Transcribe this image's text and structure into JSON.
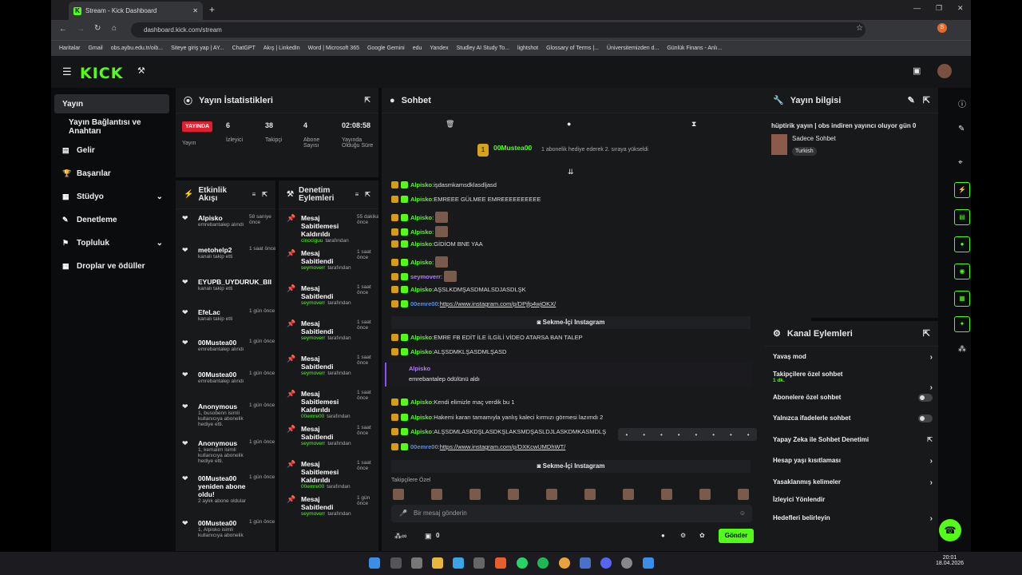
{
  "browser": {
    "tab_title": "Stream - Kick Dashboard",
    "url": "dashboard.kick.com/stream",
    "bookmarks": [
      "Haritalar",
      "Gmail",
      "obs.aybu.edu.tr/oib...",
      "Siteye giriş yap | AY...",
      "ChatGPT",
      "Akış | LinkedIn",
      "Word | Microsoft 365",
      "Google Gemini",
      "edu",
      "Yandex",
      "Studley AI Study To...",
      "lightshot",
      "Glossary of Terms |...",
      "Üniversitemizden d...",
      "Günlük Finans - Anlı..."
    ]
  },
  "nav": {
    "items": [
      "Yayın",
      "Yayın Bağlantısı ve Anahtarı",
      "Gelir",
      "Başarılar",
      "Stüdyo",
      "Denetleme",
      "Topluluk",
      "Droplar ve ödüller"
    ]
  },
  "stats": {
    "title": "Yayın İstatistikleri",
    "live": "YAYINDA",
    "live_label": "Yayın",
    "viewers": "6",
    "viewers_label": "İzleyici",
    "followers": "38",
    "followers_label": "Takipçi",
    "subs": "4",
    "subs_label": "Abone Sayısı",
    "duration": "02:08:58",
    "duration_label": "Yayında Olduğu Süre"
  },
  "activity": {
    "title": "Etkinlik Akışı",
    "items": [
      {
        "name": "Alpisko",
        "time": "58 saniye önce",
        "sub": "emrebantalep alındı"
      },
      {
        "name": "metohelp2",
        "time": "1 saat önce",
        "sub": "kanalı takip etti"
      },
      {
        "name": "EYUPB_UYDURUK_BII",
        "time": "",
        "sub": "kanalı takip etti"
      },
      {
        "name": "EfeLac",
        "time": "1 gün önce",
        "sub": "kanalı takip etti"
      },
      {
        "name": "00Mustea00",
        "time": "1 gün önce",
        "sub": "emrebantalep alındı"
      },
      {
        "name": "00Mustea00",
        "time": "1 gün önce",
        "sub": "emrebantalep alındı"
      },
      {
        "name": "Anonymous",
        "time": "1 gün önce",
        "sub": "1, busobenn isimli kullanıcıya abonelik hediye etti."
      },
      {
        "name": "Anonymous",
        "time": "1 gün önce",
        "sub": "1, kemalim isimli kullanıcıya abonelik hediye etti."
      },
      {
        "name": "00Mustea00 yeniden abone oldu!",
        "time": "1 gün önce",
        "sub": "2 aylık abone oldular"
      },
      {
        "name": "00Mustea00",
        "time": "1 gün önce",
        "sub": "1, Alpisko isimli kullanıcıya abonelik"
      }
    ]
  },
  "moderation": {
    "title": "Denetim Eylemleri",
    "items": [
      {
        "title": "Mesaj Sabitlemesi Kaldırıldı",
        "time": "55 dakika önce",
        "by": "cinociguu",
        "by_suffix": "tarafından"
      },
      {
        "title": "Mesaj Sabitlendi",
        "time": "1 saat önce",
        "by": "seymoverr",
        "by_suffix": "tarafından"
      },
      {
        "title": "Mesaj Sabitlendi",
        "time": "1 saat önce",
        "by": "seymoverr",
        "by_suffix": "tarafından"
      },
      {
        "title": "Mesaj Sabitlendi",
        "time": "1 saat önce",
        "by": "seymoverr",
        "by_suffix": "tarafından"
      },
      {
        "title": "Mesaj Sabitlendi",
        "time": "1 saat önce",
        "by": "seymoverr",
        "by_suffix": "tarafından"
      },
      {
        "title": "Mesaj Sabitlemesi Kaldırıldı",
        "time": "1 saat önce",
        "by": "00emre00",
        "by_suffix": "tarafından"
      },
      {
        "title": "Mesaj Sabitlendi",
        "time": "1 saat önce",
        "by": "seymoverr",
        "by_suffix": "tarafından"
      },
      {
        "title": "Mesaj Sabitlemesi Kaldırıldı",
        "time": "1 saat önce",
        "by": "00emre00",
        "by_suffix": "tarafından"
      },
      {
        "title": "Mesaj Sabitlendi",
        "time": "1 gün önce",
        "by": "seymoverr",
        "by_suffix": "tarafından"
      }
    ]
  },
  "chat": {
    "title": "Sohbet",
    "pinned_user": "00Mustea00",
    "pinned_rank": "1",
    "pinned_text": "1 abonelik hediye ederek 2. sıraya yükseldi",
    "messages": [
      {
        "user": "Alpisko",
        "text": "işdasmkamsdklasdljasd",
        "color": "green"
      },
      {
        "user": "Alpisko",
        "text": "EMREEE GÜLMEE EMREEEEEEEEEE",
        "color": "green"
      },
      {
        "user": "Alpisko",
        "text": "",
        "color": "green"
      },
      {
        "user": "Alpisko",
        "text": "",
        "color": "green"
      },
      {
        "user": "Alpisko",
        "text": "GİDİOM BNE YAA",
        "color": "green"
      },
      {
        "user": "Alpisko",
        "text": "",
        "color": "green"
      },
      {
        "user": "seymoverr",
        "text": "",
        "color": "purple"
      },
      {
        "user": "Alpisko",
        "text": "AŞSLKDMŞASDMALSDJASDLŞK",
        "color": "green"
      },
      {
        "user": "00emre00",
        "text": "https://www.instagram.com/p/DPjfp4wjOKX/",
        "color": "blue"
      },
      {
        "user": "Alpisko",
        "text": "EMRE FB EDİT İLE İLGİLİ VİDEO ATARSA BAN TALEP",
        "color": "green"
      },
      {
        "user": "Alpisko",
        "text": "ALŞSDMKLŞASDMLŞASD",
        "color": "green"
      },
      {
        "user": "Alpisko",
        "text": "Kendi elimizle maç verdik bu 1",
        "color": "green"
      },
      {
        "user": "Alpisko",
        "text": "Hakemi kararı tamamıyla yanlış kaleci kırmızı görmesi lazımdı 2",
        "color": "green"
      },
      {
        "user": "Alpisko",
        "text": "ALŞSDMLASKDŞLASDKŞLAKSMDŞASLDJLASKDMKASMDLŞ",
        "color": "green"
      },
      {
        "user": "00emre00",
        "text": "https://www.instagram.com/p/DXKcwUMDhWT/",
        "color": "blue"
      }
    ],
    "sekme": "Sekme-İçi Instagram",
    "redeem_user": "Alpisko",
    "redeem_text": "emrebantalep ödülünü aldı",
    "follower_label": "Takipçilere Özel",
    "input_placeholder": "Bir mesaj gönderin",
    "send": "Gönder",
    "count": "0"
  },
  "info": {
    "title": "Yayın bilgisi",
    "stream_title": "hüptirik yayın | obs indiren yayıncı oluyor gün 0",
    "mode": "Sadece Sohbet",
    "lang": "Turkish"
  },
  "channel": {
    "title": "Kanal Eylemleri",
    "rows": [
      "Yavaş mod",
      "Takipçilere özel sohbet",
      "Abonelere özel sohbet",
      "Yalnızca ifadelerle sohbet",
      "Yapay Zeka ile Sohbet Denetimi",
      "Hesap yaşı kısıtlaması",
      "Yasaklanmış kelimeler",
      "İzleyici Yönlendir",
      "Hedefleri belirleyin"
    ],
    "followers_sub": "1 dk."
  },
  "clock": {
    "time": "20:01",
    "date": "18.04.2026"
  }
}
